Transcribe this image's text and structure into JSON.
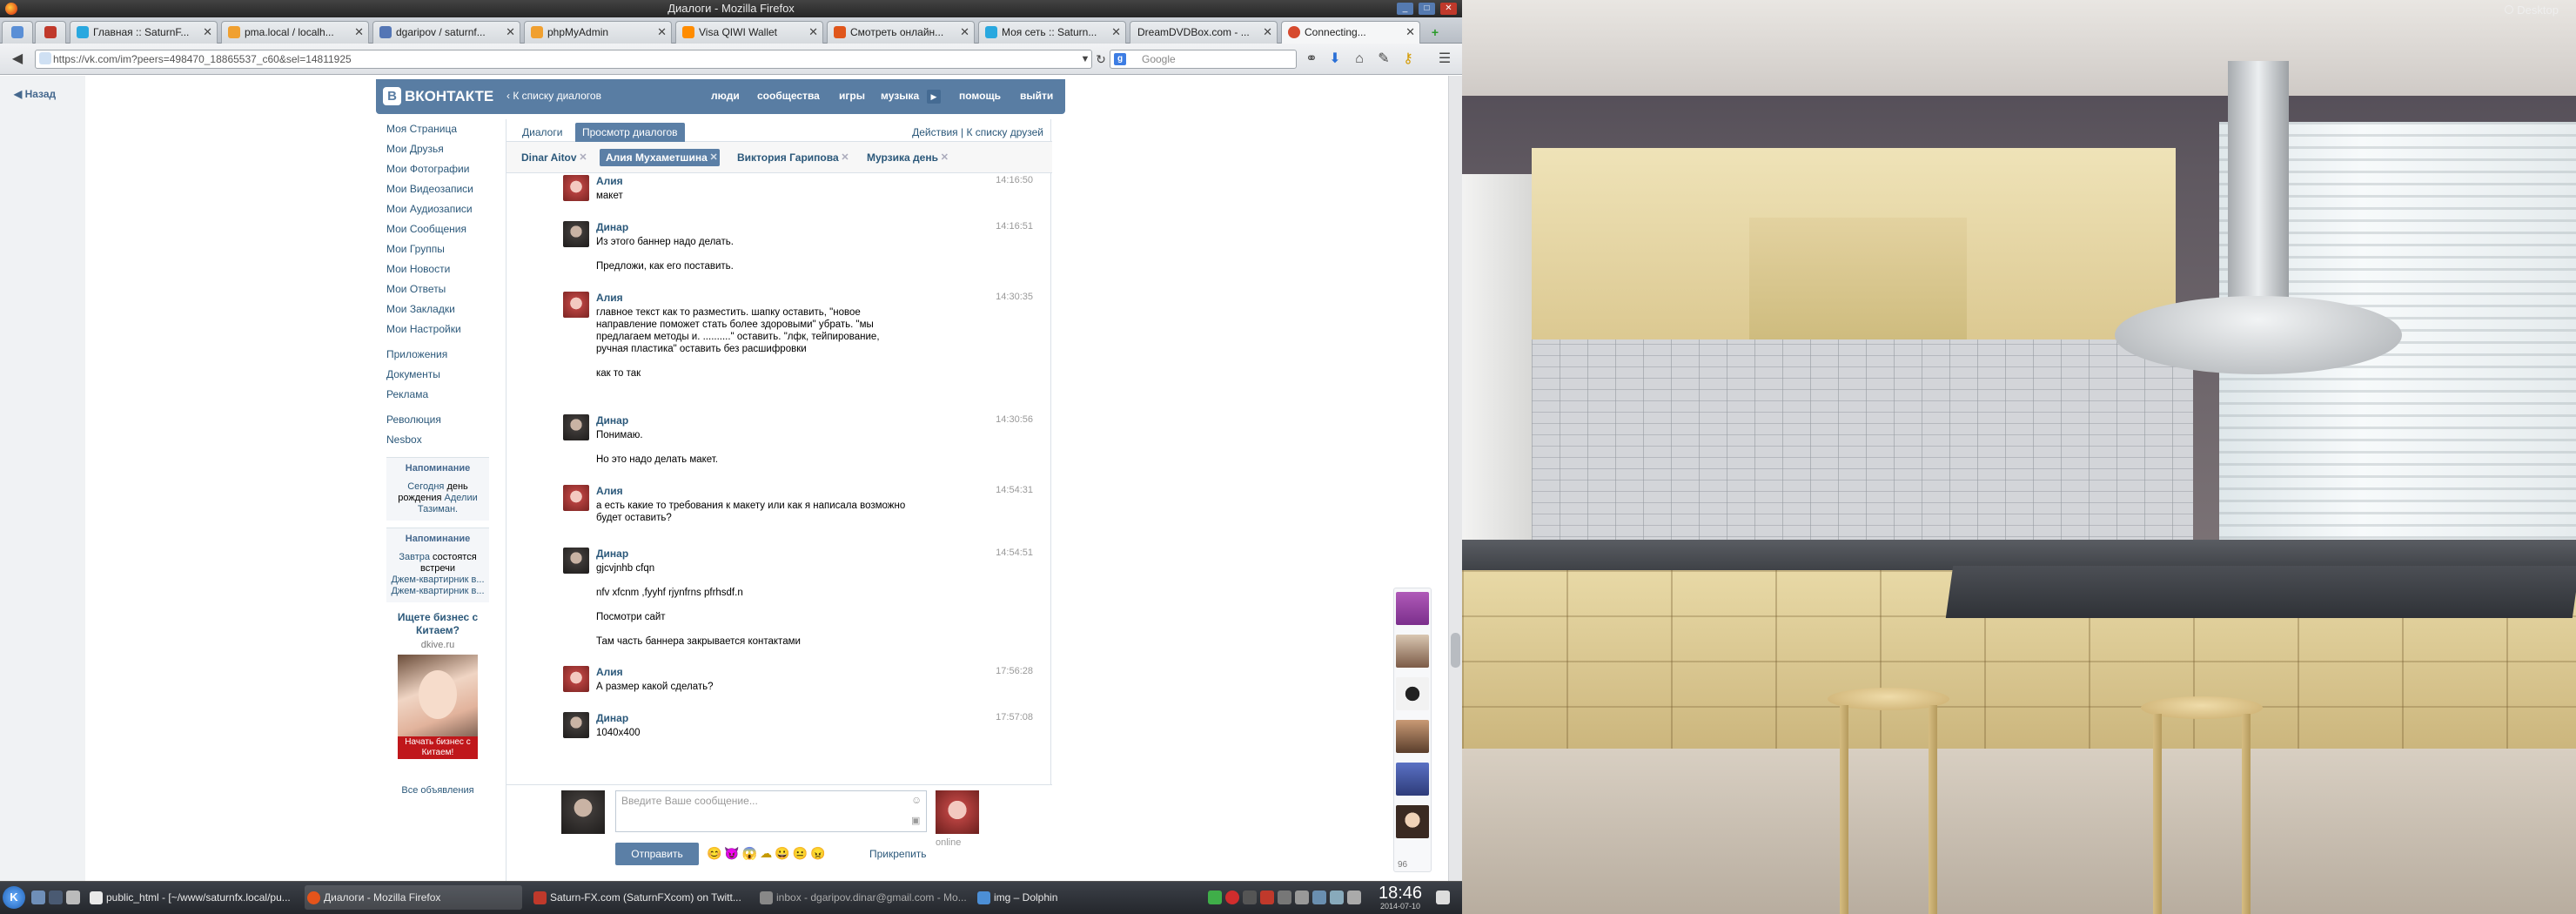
{
  "window": {
    "title": "Диалоги - Mozilla Firefox",
    "buttons": [
      "_",
      "□",
      "✕"
    ]
  },
  "tabs": [
    {
      "label": "",
      "color": "#5a8fd6"
    },
    {
      "label": "",
      "color": "#c0392b"
    },
    {
      "label": "Главная :: SaturnF...",
      "color": "#29a8df"
    },
    {
      "label": "pma.local / localh...",
      "color": "#f0a030"
    },
    {
      "label": "dgaripov / saturnf...",
      "color": "#5476b5"
    },
    {
      "label": "phpMyAdmin",
      "color": "#f0a030"
    },
    {
      "label": "Visa QIWI Wallet",
      "color": "#ff8c00"
    },
    {
      "label": "Смотреть онлайн...",
      "color": "#e0561b"
    },
    {
      "label": "Моя сеть :: Saturn...",
      "color": "#29a8df"
    },
    {
      "label": "DreamDVDBox.com - ...",
      "color": "#7aa7d8"
    },
    {
      "label": "Connecting...",
      "color": "#d64a2e"
    }
  ],
  "urlbar": {
    "url": "https://vk.com/im?peers=498470_18865537_c60&sel=14811925"
  },
  "searchbar": {
    "placeholder": "Google",
    "engine_letter": "g"
  },
  "page": {
    "back_label": "Назад",
    "header": {
      "logo": "ВКОНТАКТЕ",
      "logo_letter": "В",
      "back_to_dialogs": "К списку диалогов",
      "links": [
        "люди",
        "сообщества",
        "игры",
        "музыка",
        "помощь",
        "выйти"
      ]
    },
    "left_menu": [
      "Моя Страница",
      "Мои Друзья",
      "Мои Фотографии",
      "Мои Видеозаписи",
      "Мои Аудиозаписи",
      "Мои Сообщения",
      "Мои Группы",
      "Мои Новости",
      "Мои Ответы",
      "Мои Закладки",
      "Мои Настройки"
    ],
    "left_menu_extra": [
      "Приложения",
      "Документы",
      "Реклама"
    ],
    "left_menu_groups": [
      "Революция",
      "Nesbox"
    ],
    "notice1": {
      "title": "Напоминание",
      "today": "Сегодня",
      "text": "день рождения",
      "name": "Аделии Тазиман."
    },
    "notice2": {
      "title": "Напоминание",
      "tomorrow": "Завтра",
      "text": "состоятся встречи",
      "ev1": "Джем-квартирник в...",
      "ev2": "Джем-квартирник в..."
    },
    "ad": {
      "title": "Ищете бизнес с Китаем?",
      "domain": "dkive.ru",
      "button": "Начать бизнес с Китаем!",
      "all": "Все объявления"
    },
    "view_tabs": [
      "Диалоги",
      "Просмотр диалогов"
    ],
    "view_tabs_right": {
      "actions": "Действия",
      "sep": "|",
      "friends": "К списку друзей"
    },
    "dialog_tabs": [
      "Dinar Aitov",
      "Алия Мухаметшина",
      "Виктория Гарипова",
      "Мурзика день"
    ],
    "messages": [
      {
        "author": "Алия",
        "gender": "f",
        "time": "14:16:50",
        "lines": [
          "макет"
        ]
      },
      {
        "author": "Динар",
        "gender": "m",
        "time": "14:16:51",
        "lines": [
          "Из этого баннер надо делать.",
          "Предложи, как его поставить."
        ]
      },
      {
        "author": "Алия",
        "gender": "f",
        "time": "14:30:35",
        "lines": [
          "главное текст как то разместить. шапку оставить, \"новое направление поможет стать более здоровыми\" убрать. \"мы предлагаем методы и. ..........\" оставить. \"лфк, тейпирование, ручная пластика\" оставить без расшифровки",
          "как то так"
        ]
      },
      {
        "author": "Динар",
        "gender": "m",
        "time": "14:30:56",
        "lines": [
          "Понимаю.",
          "Но это надо делать макет."
        ]
      },
      {
        "author": "Алия",
        "gender": "f",
        "time": "14:54:31",
        "lines": [
          "а есть какие то требования к макету или как я написала возможно будет оставить?"
        ]
      },
      {
        "author": "Динар",
        "gender": "m",
        "time": "14:54:51",
        "lines": [
          "gjcvjnhb cfqn",
          "nfv xfcnm ,fyyhf rjynfrns pfrhsdf.n",
          "Посмотри сайт",
          "Там часть баннера закрывается контактами"
        ]
      },
      {
        "author": "Алия",
        "gender": "f",
        "time": "17:56:28",
        "lines": [
          "А размер какой сделать?"
        ]
      },
      {
        "author": "Динар",
        "gender": "m",
        "time": "17:57:08",
        "lines": [
          "1040x400"
        ]
      }
    ],
    "compose": {
      "placeholder": "Введите Ваше сообщение...",
      "send": "Отправить",
      "attach": "Прикрепить",
      "online": "online",
      "smiles": "😊😈😱☁😀😐😠"
    },
    "im_counter": "96"
  },
  "desktop": {
    "label": "Desktop"
  },
  "taskbar": {
    "items": [
      {
        "label": "public_html - [~/www/saturnfx.local/pu...",
        "color": "#e9e9e9"
      },
      {
        "label": "Диалоги - Mozilla Firefox",
        "color": "#e5541b"
      },
      {
        "label": "Saturn-FX.com (SaturnFXcom) on Twitt...",
        "color": "#c0392b"
      },
      {
        "label": "inbox - dgaripov.dinar@gmail.com - Mo...",
        "color": "#888"
      },
      {
        "label": "img – Dolphin",
        "color": "#4c8fd6"
      }
    ],
    "clock": "18:46",
    "date": "2014-07-10"
  }
}
